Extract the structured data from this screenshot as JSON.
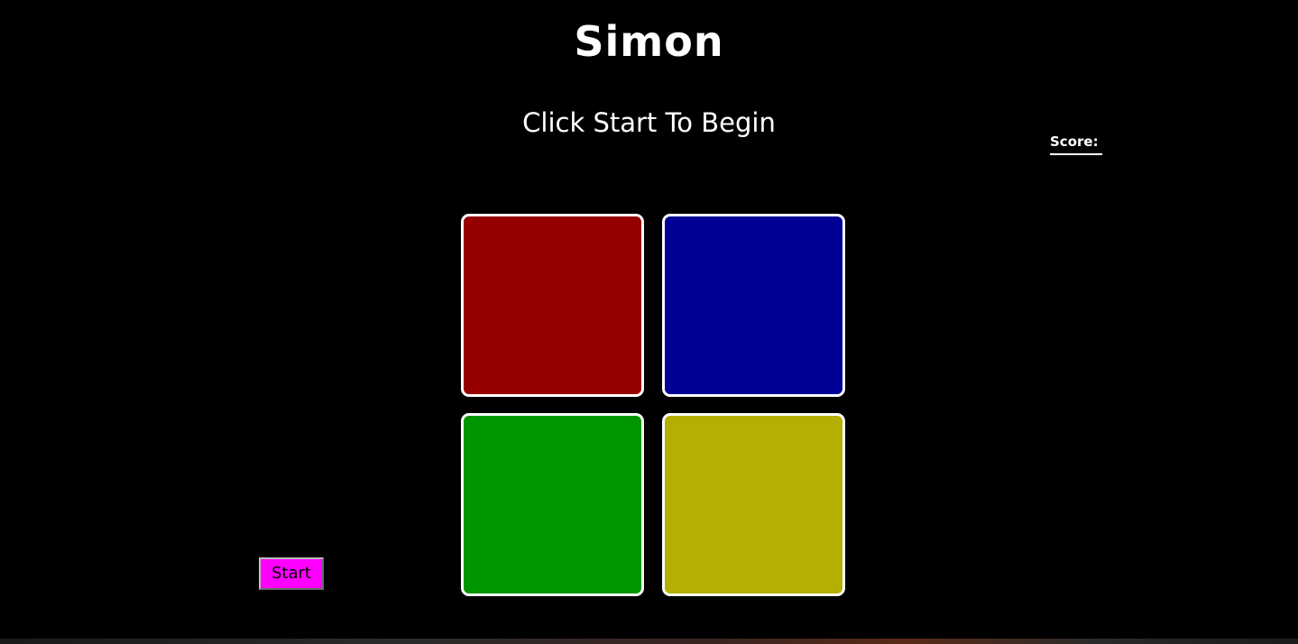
{
  "title": "Simon",
  "status": "Click Start To Begin",
  "score": {
    "label": "Score:",
    "value": ""
  },
  "pads": [
    {
      "name": "red",
      "color": "#960000"
    },
    {
      "name": "blue",
      "color": "#000096"
    },
    {
      "name": "green",
      "color": "#009600"
    },
    {
      "name": "yellow",
      "color": "#b4af00"
    }
  ],
  "start_button": {
    "label": "Start",
    "color": "#ff00ff"
  }
}
